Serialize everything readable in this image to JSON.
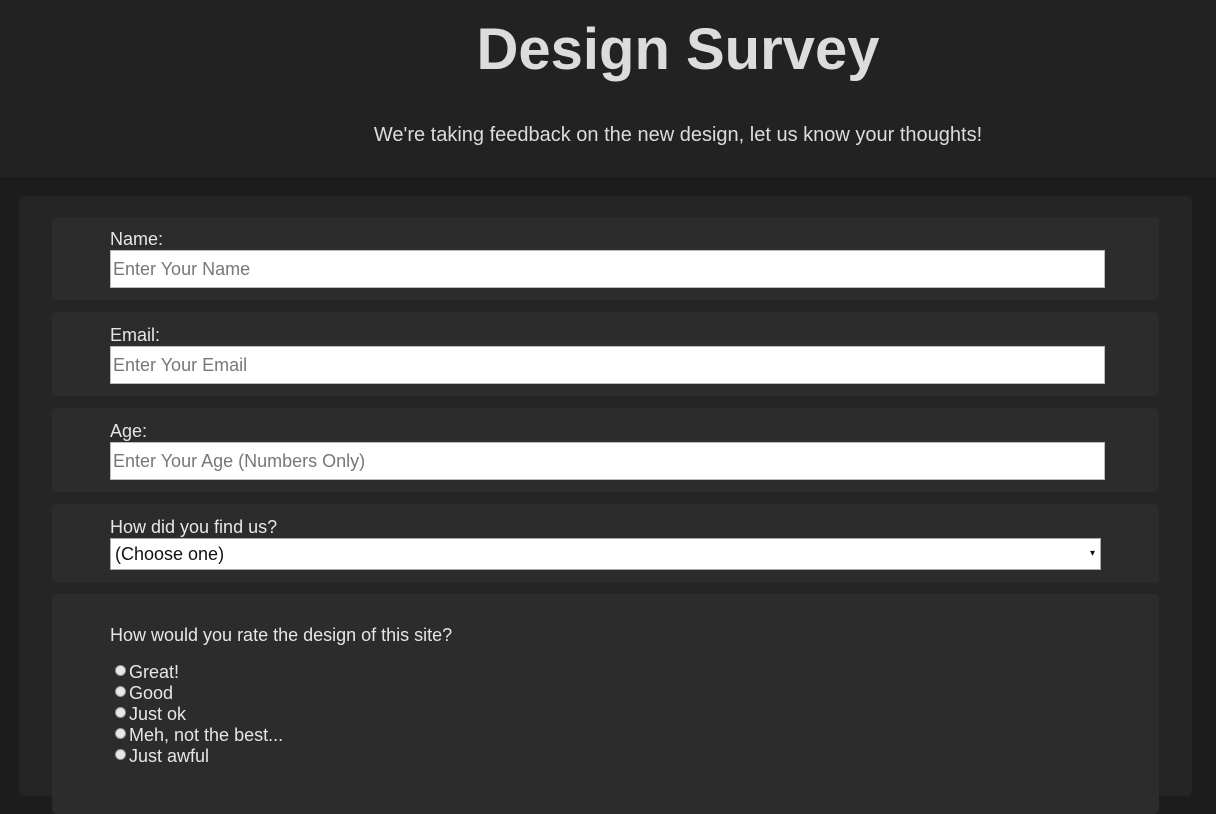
{
  "header": {
    "title": "Design Survey",
    "subtitle": "We're taking feedback on the new design, let us know your thoughts!"
  },
  "form": {
    "name": {
      "label": "Name:",
      "placeholder": "Enter Your Name"
    },
    "email": {
      "label": "Email:",
      "placeholder": "Enter Your Email"
    },
    "age": {
      "label": "Age:",
      "placeholder": "Enter Your Age (Numbers Only)"
    },
    "source": {
      "label": "How did you find us?",
      "selected": "(Choose one)",
      "arrow": "▾"
    },
    "rating": {
      "question": "How would you rate the design of this site?",
      "options": [
        "Great!",
        "Good",
        "Just ok",
        "Meh, not the best...",
        "Just awful"
      ]
    }
  },
  "colors": {
    "page_background": "#1c1c1c",
    "header_background": "#222222",
    "form_background": "#252525",
    "group_background": "#2c2c2c",
    "text": "#e6e6e6"
  }
}
